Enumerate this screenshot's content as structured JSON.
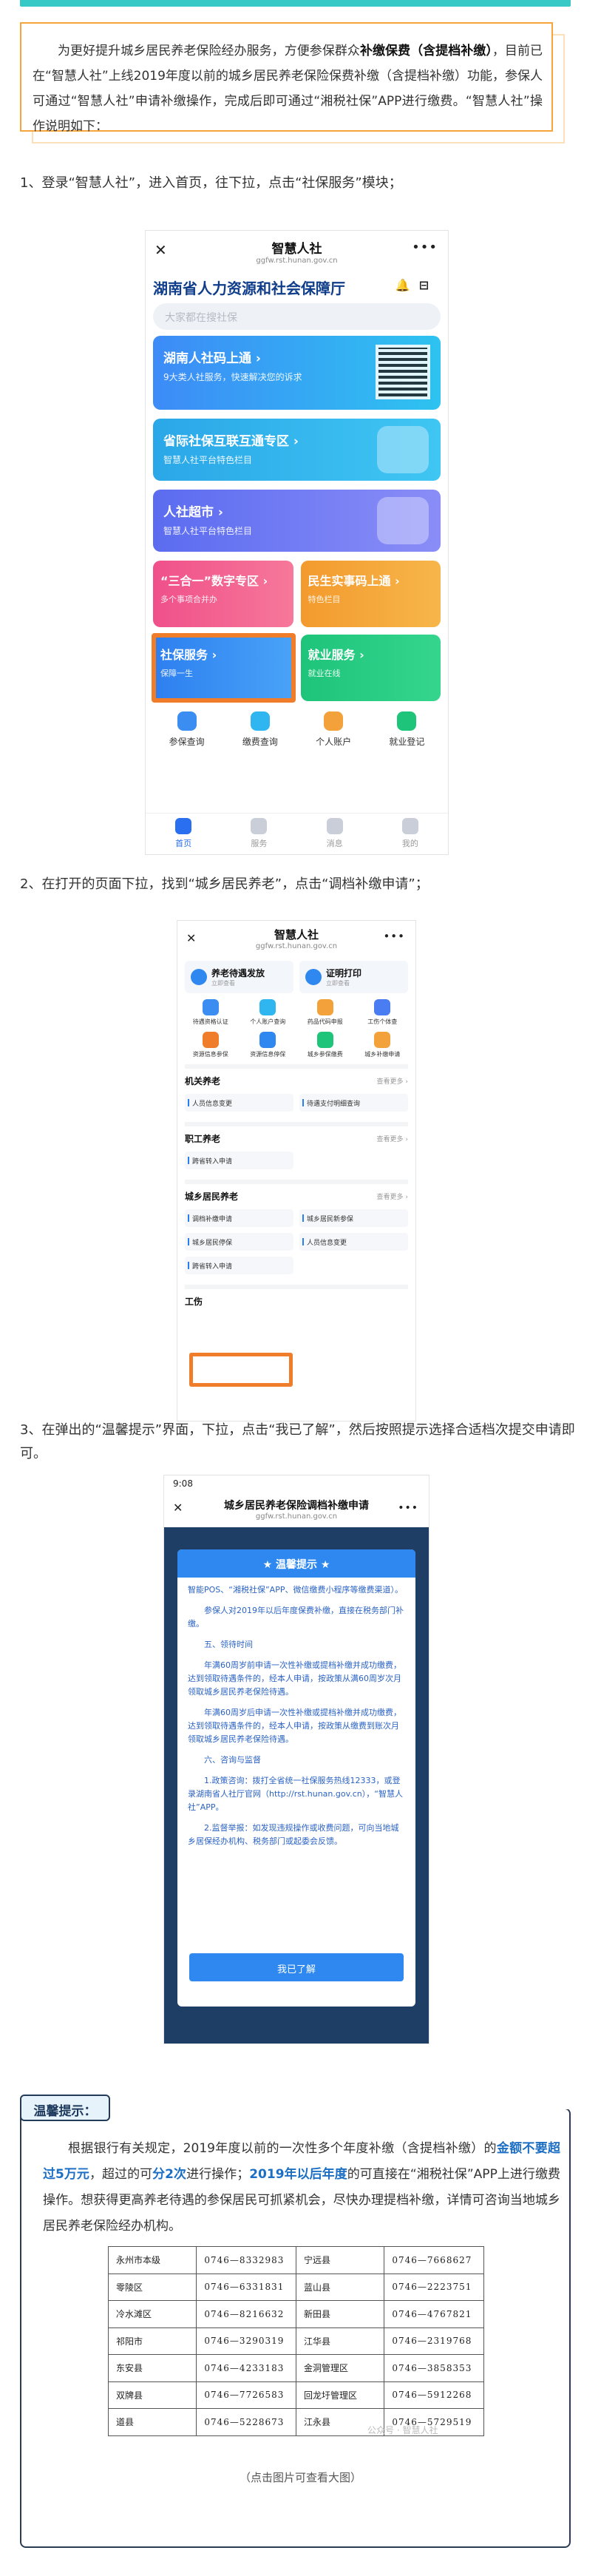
{
  "intro": {
    "p1": "为更好提升城乡居民养老保险经办服务，方便参保群众",
    "bold": "补缴保费（含提档补缴）",
    "p2": "，目前已在“智慧人社”上线2019年度以前的城乡居民养老保险保费补缴（含提档补缴）功能，参保人可通过“智慧人社”申请补缴操作，完成后即可通过“湘税社保”APP进行缴费。“智慧人社”操作说明如下："
  },
  "steps": [
    "1、登录“智慧人社”，进入首页，往下拉，点击“社保服务”模块；",
    "2、在打开的页面下拉，找到“城乡居民养老”，点击“调档补缴申请”；",
    "3、在弹出的“温馨提示”界面，下拉，点击“我已了解”，然后按照提示选择合适档次提交申请即可。"
  ],
  "screen1": {
    "title": "智慧人社",
    "url": "ggfw.rst.hunan.gov.cn",
    "dept": "湖南省人力资源和社会保障厅",
    "search_placeholder": "大家都在搜社保",
    "cards": [
      {
        "title": "湖南人社码上通 ›",
        "sub": "9大类人社服务，快速解决您的诉求"
      },
      {
        "title": "省际社保互联互通专区 ›",
        "sub": "智慧人社平台特色栏目"
      },
      {
        "title": "人社超市 ›",
        "sub": "智慧人社平台特色栏目"
      }
    ],
    "tiles": [
      {
        "title": "“三合一”数字专区 ›",
        "sub": "多个事项合并办"
      },
      {
        "title": "民生实事码上通 ›",
        "sub": "特色栏目"
      },
      {
        "title": "社保服务 ›",
        "sub": "保障一生"
      },
      {
        "title": "就业服务 ›",
        "sub": "就业在线"
      }
    ],
    "icons": [
      "参保查询",
      "缴费查询",
      "个人账户",
      "就业登记"
    ],
    "tabs": [
      "首页",
      "服务",
      "消息",
      "我的"
    ]
  },
  "screen2": {
    "title": "智慧人社",
    "url": "ggfw.rst.hunan.gov.cn",
    "quick": [
      {
        "label": "养老待遇发放",
        "sub": "立即查看"
      },
      {
        "label": "证明打印",
        "sub": "立即查看"
      }
    ],
    "grid": [
      "待遇资格认证",
      "个人账户查询",
      "药品代码申报",
      "工伤个体查",
      "资源信息参保",
      "资源信息停保",
      "城乡参保缴费",
      "城乡补缴申请"
    ],
    "sections": [
      {
        "title": "机关养老",
        "more": "查看更多 ›",
        "items": [
          "人员信息变更",
          "待遇支付明细查询"
        ]
      },
      {
        "title": "职工养老",
        "more": "查看更多 ›",
        "items": [
          "跨省转入申请"
        ]
      },
      {
        "title": "城乡居民养老",
        "more": "查看更多 ›",
        "items": [
          "调档补缴申请",
          "城乡居民新参保",
          "城乡居民停保",
          "人员信息变更",
          "跨省转入申请"
        ]
      }
    ],
    "cut_section": "工伤"
  },
  "screen3": {
    "time": "9:08",
    "title": "城乡居民养老保险调档补缴申请",
    "url": "ggfw.rst.hunan.gov.cn",
    "dialog_title": "★ 温馨提示 ★",
    "paras": [
      "智能POS、“湘税社保”APP、微信缴费小程序等缴费渠道）。",
      "参保人对2019年以后年度保费补缴，直接在税务部门补缴。",
      "五、领待时间",
      "年满60周岁前申请一次性补缴或提档补缴并成功缴费，达到领取待遇条件的，经本人申请，按政策从满60周岁次月领取城乡居民养老保险待遇。",
      "年满60周岁后申请一次性补缴或提档补缴并成功缴费，达到领取待遇条件的，经本人申请，按政策从缴费到账次月领取城乡居民养老保险待遇。",
      "六、咨询与监督",
      "1.政策咨询：拨打全省统一社保服务热线12333，或登录湖南省人社厅官网（http://rst.hunan.gov.cn），“智慧人社”APP。",
      "2.监督举报：如发现违规操作或收费问题，可向当地城乡居保经办机构、税务部门或起委会反馈。"
    ],
    "button": "我已了解"
  },
  "tips": {
    "tag": "温馨提示：",
    "t1": "根据银行有关规定，2019年度以前的一次性多个年度补缴（含提档补缴）的",
    "b1": "金额不要超过5万元",
    "t2": "，超过的可",
    "b2": "分2次",
    "t3": "进行操作；",
    "b3": "2019年以后年度",
    "t4": "的可直接在“湘税社保”APP上进行缴费操作。想获得更高养老待遇的参保居民可抓紧机会，尽快办理提档补缴，详情可咨询当地城乡居民养老保险经办机构。",
    "caption": "（点击图片可查看大图）",
    "watermark": "公众号 · 智慧人社"
  },
  "contacts": [
    [
      "永州市本级",
      "0746—8332983",
      "宁远县",
      "0746—7668627"
    ],
    [
      "零陵区",
      "0746—6331831",
      "蓝山县",
      "0746—2223751"
    ],
    [
      "冷水滩区",
      "0746—8216632",
      "新田县",
      "0746—4767821"
    ],
    [
      "祁阳市",
      "0746—3290319",
      "江华县",
      "0746—2319768"
    ],
    [
      "东安县",
      "0746—4233183",
      "金洞管理区",
      "0746—3858353"
    ],
    [
      "双牌县",
      "0746—7726583",
      "回龙圩管理区",
      "0746—5912268"
    ],
    [
      "道县",
      "0746—5228673",
      "江永县",
      "0746—5729519"
    ]
  ]
}
